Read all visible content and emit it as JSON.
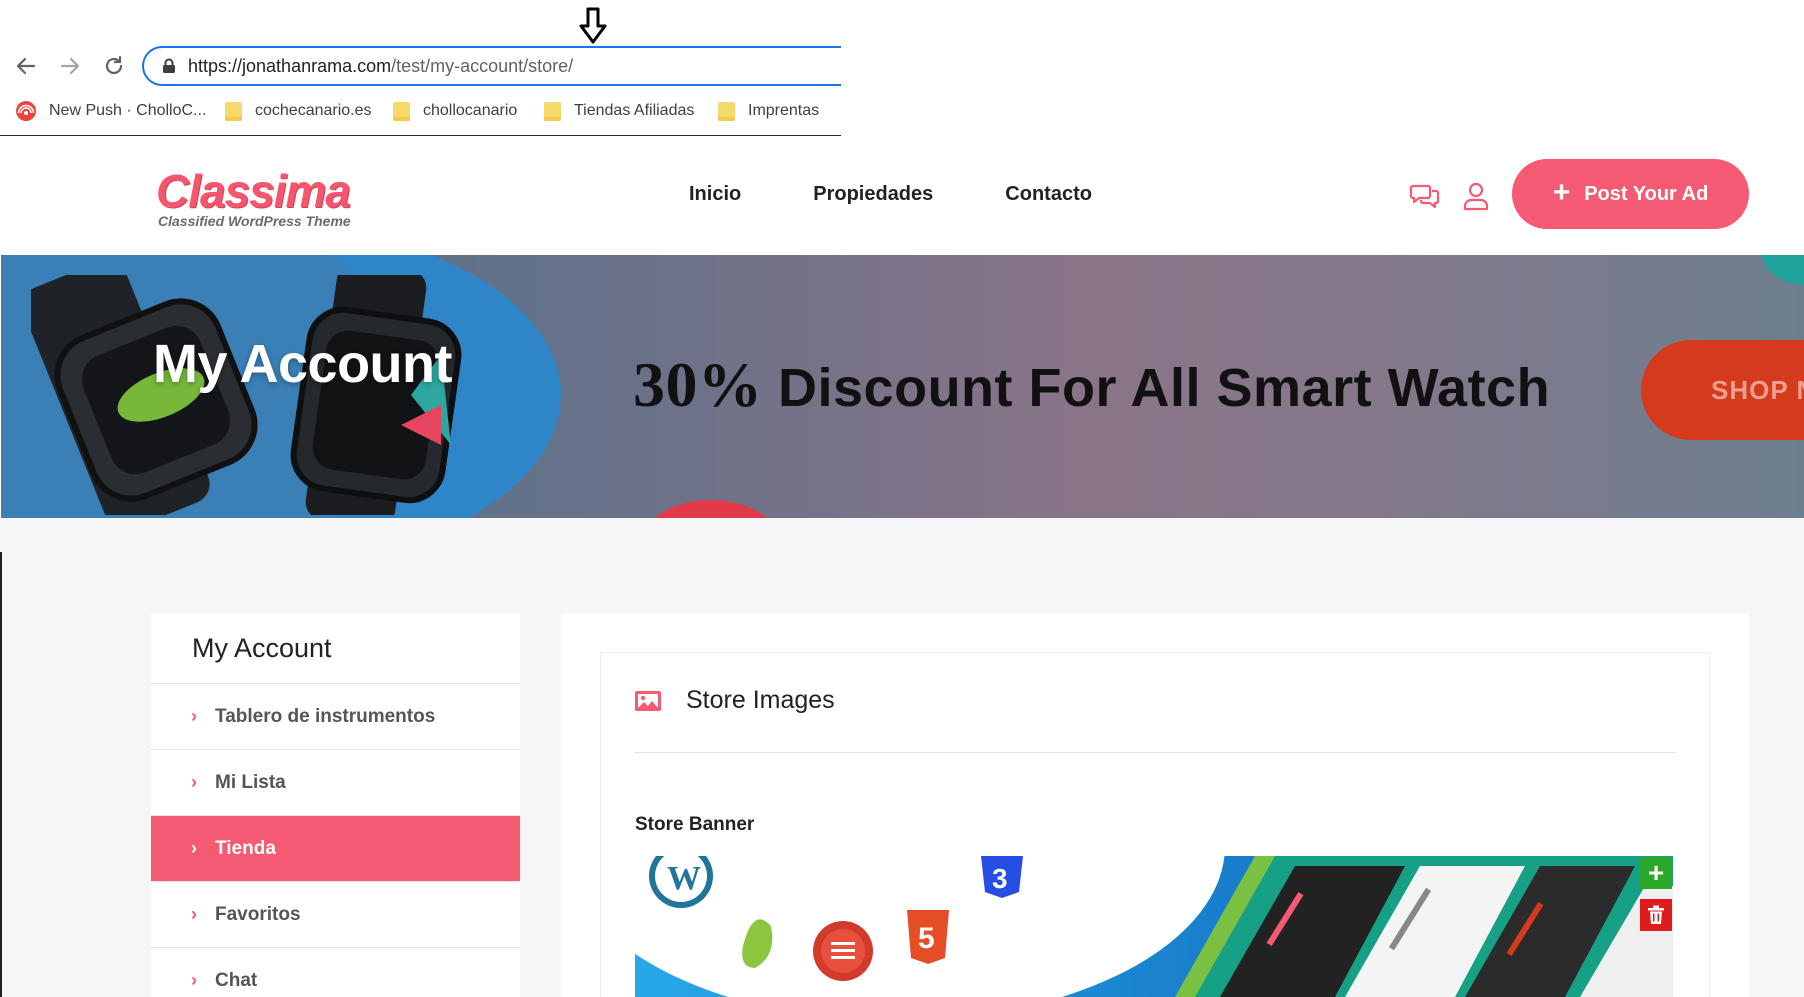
{
  "browser": {
    "url_host": "https://jonathanrama.com",
    "url_path": "/test/my-account/store/",
    "bookmarks": [
      {
        "label": "New Push · CholloC...",
        "icon": "broadcast-icon"
      },
      {
        "label": "cochecanario.es",
        "icon": "folder-icon"
      },
      {
        "label": "chollocanario",
        "icon": "folder-icon"
      },
      {
        "label": "Tiendas Afiliadas",
        "icon": "folder-icon"
      },
      {
        "label": "Imprentas",
        "icon": "folder-icon"
      }
    ]
  },
  "site": {
    "logo_word": "Classima",
    "logo_tagline": "Classified WordPress Theme",
    "nav": [
      "Inicio",
      "Propiedades",
      "Contacto"
    ],
    "post_ad_label": "Post Your Ad",
    "accent_color": "#f45b72"
  },
  "banner": {
    "title": "My Account",
    "promo_percent": "30%",
    "promo_text": "Discount For All Smart Watch",
    "shop_label": "SHOP N"
  },
  "sidebar": {
    "title": "My Account",
    "items": [
      {
        "label": "Tablero de instrumentos",
        "active": false
      },
      {
        "label": "Mi Lista",
        "active": false
      },
      {
        "label": "Tienda",
        "active": true
      },
      {
        "label": "Favoritos",
        "active": false
      },
      {
        "label": "Chat",
        "active": false
      }
    ]
  },
  "store": {
    "section_title": "Store Images",
    "banner_label": "Store Banner",
    "add_label": "+"
  }
}
